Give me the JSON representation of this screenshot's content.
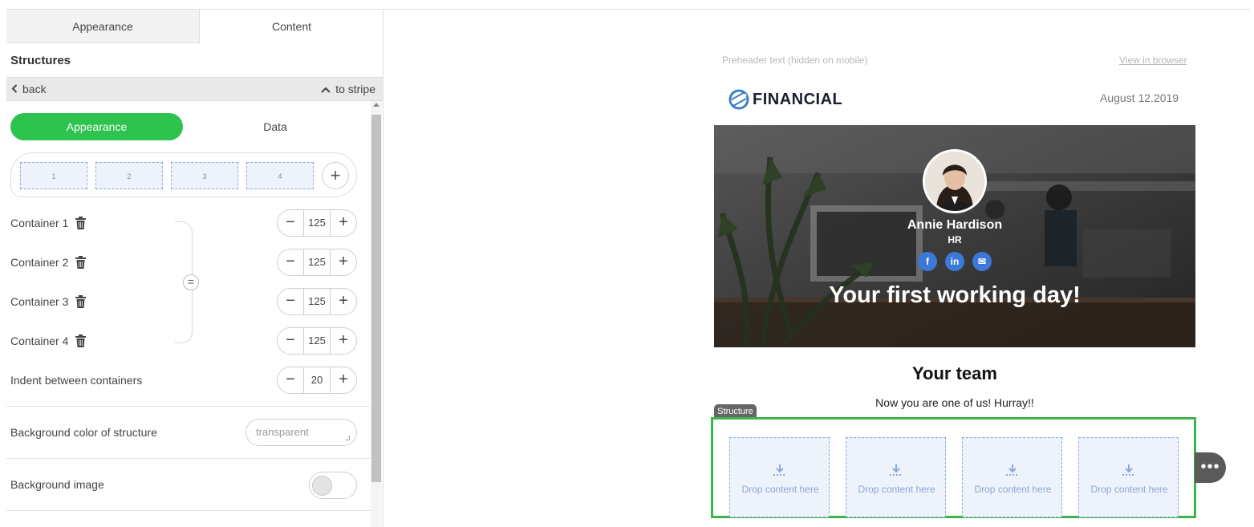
{
  "editor": {
    "tabs": [
      {
        "label": "Appearance"
      },
      {
        "label": "Content"
      }
    ],
    "section_title": "Structures",
    "back_label": "back",
    "stripe_label": "to stripe",
    "subtabs": [
      {
        "label": "Appearance"
      },
      {
        "label": "Data"
      }
    ],
    "columns": [
      "1",
      "2",
      "3",
      "4"
    ],
    "containers": [
      {
        "label": "Container 1",
        "value": "125"
      },
      {
        "label": "Container 2",
        "value": "125"
      },
      {
        "label": "Container 3",
        "value": "125"
      },
      {
        "label": "Container 4",
        "value": "125"
      }
    ],
    "indent": {
      "label": "Indent between containers",
      "value": "20"
    },
    "bg_color": {
      "label": "Background color of structure",
      "value": "transparent"
    },
    "bg_image": {
      "label": "Background image",
      "enabled": false
    },
    "accent_color": "#2ec24f",
    "icons": {
      "trash": "trash-icon",
      "plus": "plus-icon",
      "minus": "minus-icon",
      "equal": "equal-icon",
      "chevron_left": "chevron-left-icon",
      "chevron_up": "chevron-up-icon"
    }
  },
  "preview": {
    "preheader": "Preheader text (hidden on mobile)",
    "view_in_browser": "View in browser",
    "logo_text": "FINANCIAL",
    "date": "August 12.2019",
    "hero": {
      "name": "Annie Hardison",
      "role": "HR",
      "title": "Your first working day!",
      "social": [
        {
          "icon": "facebook-icon",
          "label": "f"
        },
        {
          "icon": "linkedin-icon",
          "label": "in"
        },
        {
          "icon": "email-icon",
          "label": "✉"
        }
      ]
    },
    "team_title": "Your team",
    "team_subtitle": "Now you are one of us! Hurray!!",
    "structure_tag": "Structure",
    "drop_label": "Drop content here",
    "drop_cells": [
      "Drop content here",
      "Drop content here",
      "Drop content here",
      "Drop content here"
    ],
    "more_label": "•••",
    "structure_border_color": "#3cb54a"
  }
}
